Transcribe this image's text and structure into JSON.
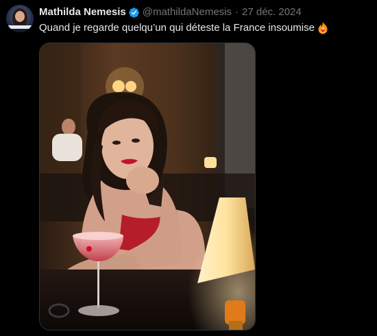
{
  "tweet": {
    "author_name": "Mathilda Nemesis",
    "handle": "@mathildaNemesis",
    "separator": "·",
    "date": "27 déc. 2024",
    "text": "Quand je regarde quelqu’un qui déteste la France insoumise"
  },
  "icons": {
    "verified": "verified-badge-icon",
    "emoji": "fire-heart-emoji-icon"
  },
  "colors": {
    "background": "#000000",
    "text_primary": "#e7e9ea",
    "text_secondary": "#71767b",
    "verified": "#1d9bf0",
    "media_border": "#2f3336"
  }
}
